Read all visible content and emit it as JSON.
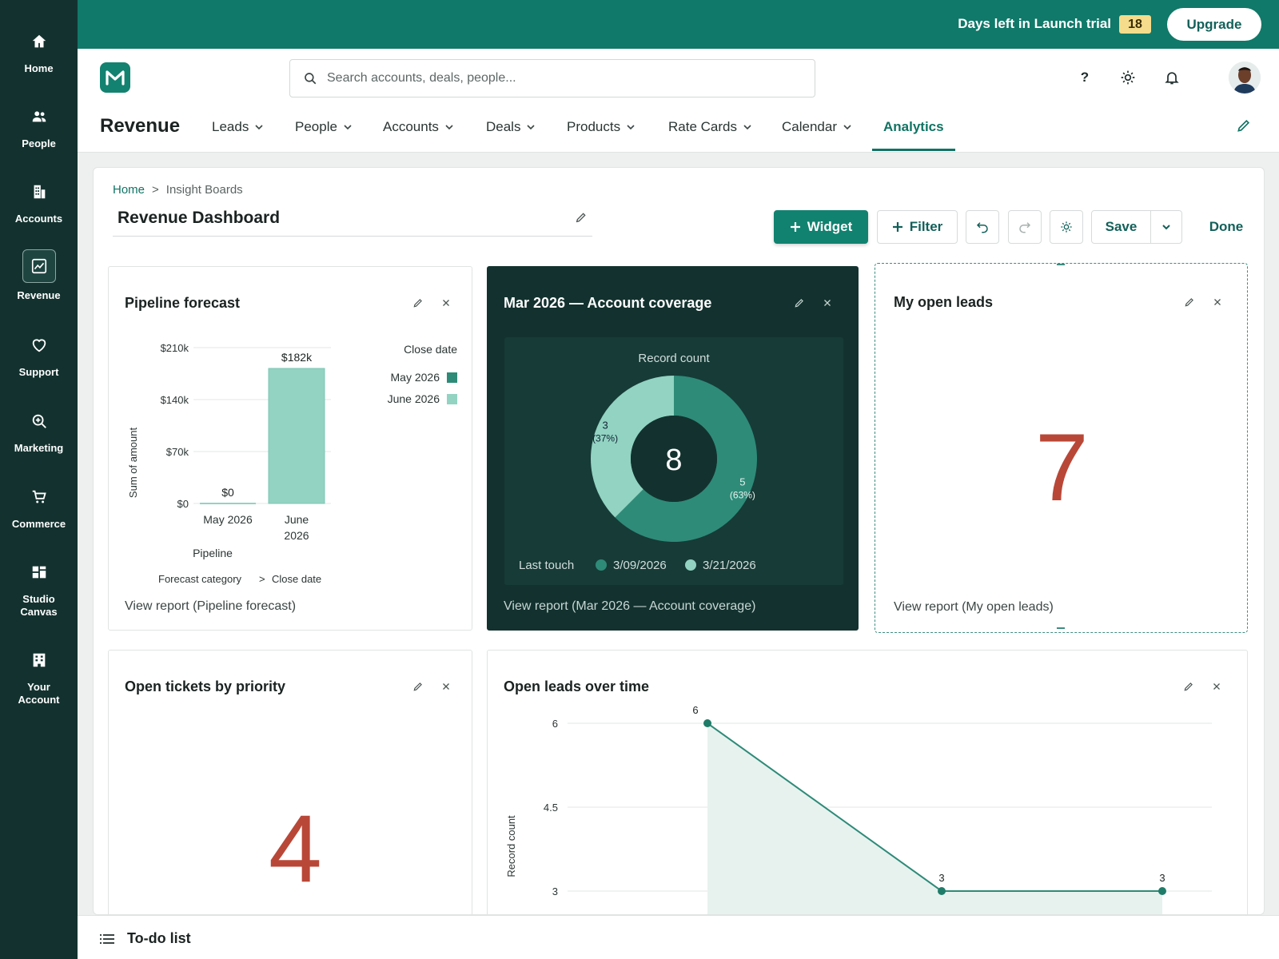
{
  "sidebar": {
    "items": [
      {
        "label": "Home",
        "icon": "home-icon"
      },
      {
        "label": "People",
        "icon": "people-icon"
      },
      {
        "label": "Accounts",
        "icon": "building-icon"
      },
      {
        "label": "Revenue",
        "icon": "chart-icon"
      },
      {
        "label": "Support",
        "icon": "heart-icon"
      },
      {
        "label": "Marketing",
        "icon": "magnify-plus-icon"
      },
      {
        "label": "Commerce",
        "icon": "cart-icon"
      },
      {
        "label": "Studio Canvas",
        "icon": "canvas-icon"
      },
      {
        "label": "Your Account",
        "icon": "office-icon"
      }
    ],
    "active": "Revenue"
  },
  "banner": {
    "trial_text": "Days left in Launch trial",
    "trial_days": "18",
    "upgrade_label": "Upgrade"
  },
  "header": {
    "search_placeholder": "Search accounts, deals, people...",
    "help_label": "?",
    "app_title": "Revenue",
    "tabs": [
      {
        "label": "Leads"
      },
      {
        "label": "People"
      },
      {
        "label": "Accounts"
      },
      {
        "label": "Deals"
      },
      {
        "label": "Products"
      },
      {
        "label": "Rate Cards"
      },
      {
        "label": "Calendar"
      },
      {
        "label": "Analytics"
      }
    ],
    "active_tab": "Analytics"
  },
  "dashboard": {
    "breadcrumb_home": "Home",
    "breadcrumb_sep": ">",
    "breadcrumb_current": "Insight Boards",
    "title": "Revenue Dashboard",
    "toolbar": {
      "widget_label": "Widget",
      "filter_label": "Filter",
      "save_label": "Save",
      "done_label": "Done"
    }
  },
  "cards": {
    "pipeline": {
      "title": "Pipeline forecast",
      "link": "View report (Pipeline forecast)",
      "legend_title": "Close date",
      "footer_a": "Forecast category",
      "footer_sep": ">",
      "footer_b": "Close date"
    },
    "coverage": {
      "title": "Mar 2026 — Account coverage",
      "link": "View report (Mar 2026 — Account coverage)",
      "center": "8",
      "legend_title": "Last touch"
    },
    "open_leads": {
      "title": "My open leads",
      "value": "7",
      "link": "View report (My open leads)"
    },
    "tickets": {
      "title": "Open tickets by priority",
      "value": "4"
    },
    "leads_time": {
      "title": "Open leads over time"
    }
  },
  "colors": {
    "accent": "#107363",
    "dark_teal": "#2e8b78",
    "light_teal": "#92d3c2",
    "big_number": "#b94737"
  },
  "chart_data": [
    {
      "type": "bar",
      "title": "Pipeline forecast",
      "xlabel": "Pipeline",
      "ylabel": "Sum of amount",
      "categories": [
        "May 2026",
        "June 2026"
      ],
      "series": [
        {
          "name": "May 2026",
          "values": [
            0,
            0
          ],
          "color": "#2e8b78"
        },
        {
          "name": "June 2026",
          "values": [
            0,
            182000
          ],
          "color": "#92d3c2"
        }
      ],
      "data_labels": [
        "$0",
        "$182k"
      ],
      "yticks": [
        "$0",
        "$70k",
        "$140k",
        "$210k"
      ],
      "ylim": [
        0,
        210000
      ],
      "legend": "right"
    },
    {
      "type": "pie",
      "title": "Record count",
      "slices": [
        {
          "name": "3/09/2026",
          "value": 5,
          "label": "5",
          "pct": "(63%)",
          "color": "#2e8b78"
        },
        {
          "name": "3/21/2026",
          "value": 3,
          "label": "3",
          "pct": "(37%)",
          "color": "#92d3c2"
        }
      ],
      "legend": "bottom"
    },
    {
      "type": "area",
      "title": "Open leads over time",
      "ylabel": "Record count",
      "values": [
        6,
        3,
        3
      ],
      "yticks": [
        "3",
        "4.5",
        "6"
      ],
      "ylim": [
        3,
        6
      ]
    }
  ],
  "todo": {
    "label": "To-do list"
  }
}
